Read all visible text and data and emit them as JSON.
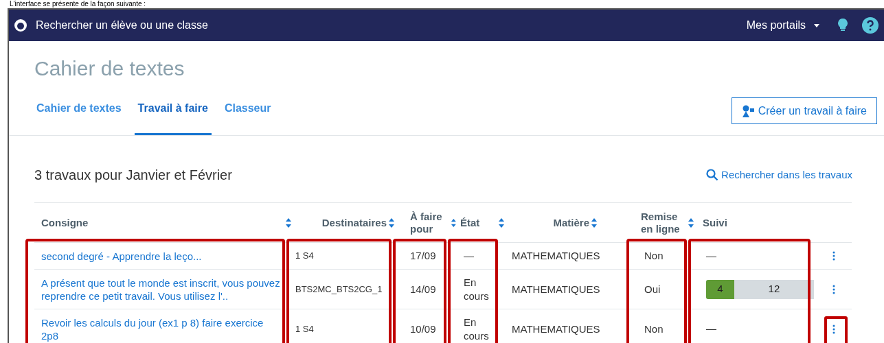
{
  "caption": "L'interface se présente de la façon suivante :",
  "topbar": {
    "search": "Rechercher un élève ou une classe",
    "portals": "Mes portails"
  },
  "page_title": "Cahier de textes",
  "tabs": [
    {
      "label": "Cahier de textes",
      "selected": false
    },
    {
      "label": "Travail à faire",
      "selected": true
    },
    {
      "label": "Classeur",
      "selected": false
    }
  ],
  "create_button": "Créer un travail à faire",
  "list_title": "3 travaux pour Janvier et Février",
  "search_link": "Rechercher dans les travaux",
  "table": {
    "columns": [
      {
        "label": "Consigne",
        "sortable": true,
        "highlighted": true
      },
      {
        "label": "Destinataires",
        "sortable": true,
        "highlighted": true
      },
      {
        "label": "À faire pour",
        "sortable": true,
        "highlighted": true
      },
      {
        "label": "État",
        "sortable": true,
        "highlighted": true
      },
      {
        "label": "Matière",
        "sortable": true,
        "highlighted": false
      },
      {
        "label": "Remise en ligne",
        "sortable": true,
        "highlighted": true
      },
      {
        "label": "Suivi",
        "sortable": false,
        "highlighted": true
      }
    ],
    "rows": [
      {
        "consigne": "second degré - Apprendre la leço...",
        "destinataires": "1 S4",
        "date": "17/09",
        "etat": "—",
        "matiere": "MATHEMATIQUES",
        "remise": "Non",
        "suivi": {
          "kind": "dash",
          "text": "—"
        },
        "menu_highlighted": false
      },
      {
        "consigne": "A présent que tout le monde est inscrit, vous pouvez reprendre ce petit travail. Vous utilisez l'..",
        "destinataires": "BTS2MC_BTS2CG_1",
        "date": "14/09",
        "etat": "En cours",
        "matiere": "MATHEMATIQUES",
        "remise": "Oui",
        "suivi": {
          "kind": "bar",
          "done": "4",
          "remaining": "12",
          "level": 0.26
        },
        "menu_highlighted": false
      },
      {
        "consigne": "Revoir les calculs du jour (ex1 p 8) faire exercice 2p8",
        "destinataires": "1 S4",
        "date": "10/09",
        "etat": "En cours",
        "matiere": "MATHEMATIQUES",
        "remise": "Non",
        "suivi": {
          "kind": "dash",
          "text": "—"
        },
        "menu_highlighted": true
      }
    ]
  }
}
